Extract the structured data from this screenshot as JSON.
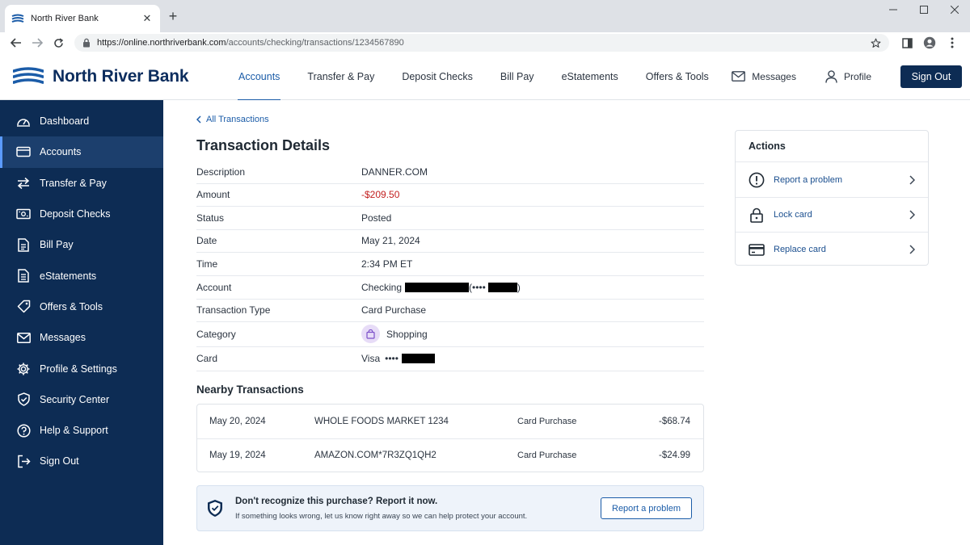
{
  "browser": {
    "tab_title": "North River Bank",
    "url_host": "https://online.northriverbank.com",
    "url_path": "/accounts/checking/transactions/1234567890"
  },
  "header": {
    "brand": "North River Bank",
    "nav": [
      "Accounts",
      "Transfer & Pay",
      "Deposit Checks",
      "Bill Pay",
      "eStatements",
      "Offers & Tools"
    ],
    "messages_label": "Messages",
    "profile_label": "Profile",
    "signout_label": "Sign Out"
  },
  "sidebar": {
    "items": [
      {
        "label": "Dashboard",
        "icon": "dashboard-icon"
      },
      {
        "label": "Accounts",
        "icon": "card-icon",
        "active": true
      },
      {
        "label": "Transfer & Pay",
        "icon": "transfer-icon"
      },
      {
        "label": "Deposit Checks",
        "icon": "check-icon"
      },
      {
        "label": "Bill Pay",
        "icon": "bill-icon"
      },
      {
        "label": "eStatements",
        "icon": "statement-icon"
      },
      {
        "label": "Offers & Tools",
        "icon": "tag-icon"
      },
      {
        "label": "Messages",
        "icon": "mail-icon"
      },
      {
        "label": "Profile & Settings",
        "icon": "gear-icon"
      },
      {
        "label": "Security Center",
        "icon": "shield-icon"
      },
      {
        "label": "Help & Support",
        "icon": "help-icon"
      },
      {
        "label": "Sign Out",
        "icon": "signout-icon"
      }
    ]
  },
  "page": {
    "back_label": "All Transactions",
    "title": "Transaction Details"
  },
  "details": {
    "description_label": "Description",
    "description": "DANNER.COM",
    "amount_label": "Amount",
    "amount": "-$209.50",
    "status_label": "Status",
    "status": "Posted",
    "date_label": "Date",
    "date": "May 21, 2024",
    "time_label": "Time",
    "time": "2:34 PM ET",
    "account_label": "Account",
    "account_prefix": "Checking",
    "account_mask_open": "(••••",
    "account_mask_close": ")",
    "type_label": "Transaction Type",
    "type": "Card Purchase",
    "category_label": "Category",
    "category": "Shopping",
    "card_label": "Card",
    "card_prefix": "Visa",
    "card_mask": "••••"
  },
  "nearby": {
    "title": "Nearby Transactions",
    "rows": [
      {
        "date": "May 20, 2024",
        "merchant": "WHOLE FOODS MARKET 1234",
        "type": "Card Purchase",
        "amount": "-$68.74"
      },
      {
        "date": "May 19, 2024",
        "merchant": "AMAZON.COM*7R3ZQ1QH2",
        "type": "Card Purchase",
        "amount": "-$24.99"
      }
    ]
  },
  "alert": {
    "heading": "Don't recognize this purchase? Report it now.",
    "body": "If something looks wrong, let us know right away so we can help protect your account.",
    "button": "Report a problem"
  },
  "actions": {
    "title": "Actions",
    "items": [
      {
        "label": "Report a problem",
        "icon": "alert-circle-icon"
      },
      {
        "label": "Lock card",
        "icon": "lock-icon"
      },
      {
        "label": "Replace card",
        "icon": "credit-card-icon"
      }
    ]
  },
  "colors": {
    "navy": "#0d2c54",
    "link": "#1b5ca8",
    "negative": "#c21f1f",
    "category_badge": "#e7dcf7"
  }
}
